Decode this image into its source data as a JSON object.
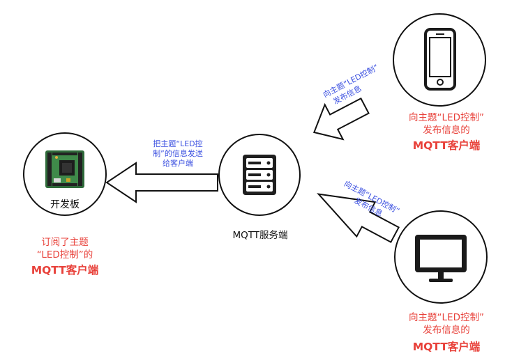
{
  "nodes": {
    "board": {
      "label": "开发板",
      "caption_lines": [
        "订阅了主题",
        "“LED控制”的"
      ],
      "caption_bold": "MQTT客户端"
    },
    "server": {
      "label": "MQTT服务端"
    },
    "phone": {
      "caption_lines": [
        "向主题“LED控制”",
        "发布信息的"
      ],
      "caption_bold": "MQTT客户端"
    },
    "monitor": {
      "caption_lines": [
        "向主题“LED控制”",
        "发布信息的"
      ],
      "caption_bold": "MQTT客户端"
    }
  },
  "arrows": {
    "server_to_board": {
      "lines": [
        "把主题“LED控",
        "制”的信息发送",
        "给客户端"
      ]
    },
    "phone_to_server": {
      "lines": [
        "向主题“LED控制”",
        "发布信息"
      ]
    },
    "monitor_to_server": {
      "lines": [
        "向主题“LED控制”",
        "发布信息"
      ]
    }
  },
  "colors": {
    "highlight": "#e8413a",
    "arrow_text": "#3a4fe0",
    "outline": "#111111"
  }
}
